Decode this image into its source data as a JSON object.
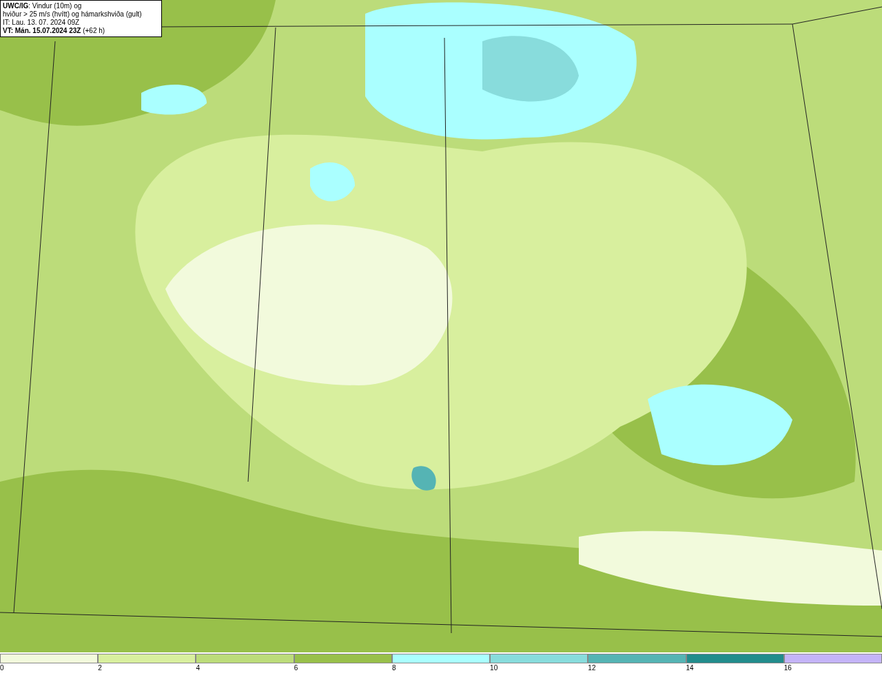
{
  "title_box": {
    "lines": [
      "**UWC/IG**: Vindur (10m) og",
      "hviður > 25 m/s (hvítt) og hámarkshviða (gult)",
      "IT: Lau. 13. 07. 2024 09Z",
      "**VT: Mán. 15.07.2024 23Z** (+62 h)"
    ]
  },
  "legend": {
    "bins": [
      {
        "label": "0",
        "color": "#f2fadc"
      },
      {
        "label": "2",
        "color": "#d8ef9e"
      },
      {
        "label": "4",
        "color": "#bcdc7a"
      },
      {
        "label": "6",
        "color": "#98c04a"
      },
      {
        "label": "8",
        "color": "#aaffff"
      },
      {
        "label": "10",
        "color": "#88dcdc"
      },
      {
        "label": "12",
        "color": "#55b4b4"
      },
      {
        "label": "14",
        "color": "#228c8c"
      },
      {
        "label": "16",
        "color": "#c4b4f8"
      }
    ]
  }
}
